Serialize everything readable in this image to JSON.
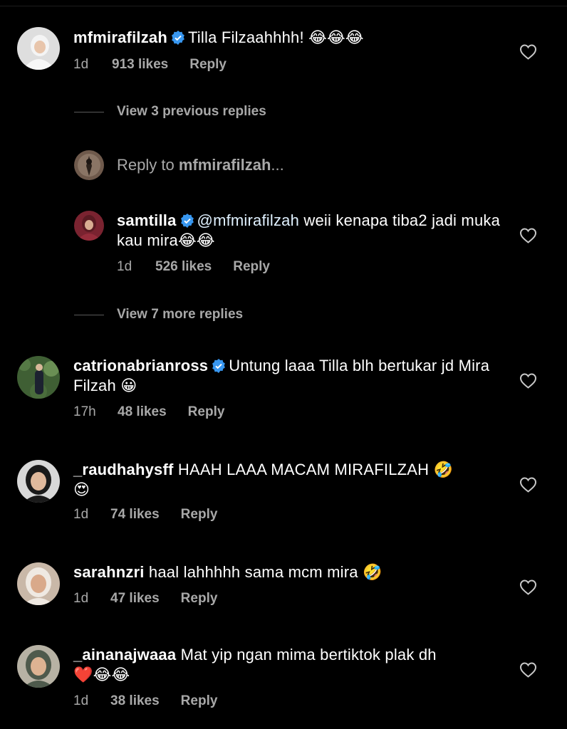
{
  "comments": [
    {
      "username": "mfmirafilzah",
      "verified": true,
      "text": "Tilla Filzaahhhh! ",
      "emoji": [
        "😂",
        "😂",
        "😂"
      ],
      "time": "1d",
      "likes": "913 likes",
      "reply": "Reply"
    },
    {
      "username": "samtilla",
      "verified": true,
      "mention": "@mfmirafilzah",
      "text": " weii kenapa tiba2 jadi muka kau mira",
      "emoji": [
        "😂",
        "😂"
      ],
      "time": "1d",
      "likes": "526 likes",
      "reply": "Reply"
    },
    {
      "username": "catrionabrianross",
      "verified": true,
      "text": "Untung laaa Tilla blh bertukar jd Mira Filzah ",
      "emoji": [
        "😀"
      ],
      "time": "17h",
      "likes": "48 likes",
      "reply": "Reply"
    },
    {
      "username": "_raudhahysff",
      "verified": false,
      "text": " HAAH LAAA MACAM MIRAFILZAH ",
      "emoji": [
        "🤣",
        "😍"
      ],
      "time": "1d",
      "likes": "74 likes",
      "reply": "Reply"
    },
    {
      "username": "sarahnzri",
      "verified": false,
      "text": " haal lahhhhh sama mcm mira ",
      "emoji": [
        "🤣"
      ],
      "time": "1d",
      "likes": "47 likes",
      "reply": "Reply"
    },
    {
      "username": "_ainanajwaaa",
      "verified": false,
      "text": " Mat yip ngan mima bertiktok plak dh",
      "emoji": [
        "❤️",
        "😂",
        "😂"
      ],
      "time": "1d",
      "likes": "38 likes",
      "reply": "Reply"
    }
  ],
  "view_previous": "View 3 previous replies",
  "view_more": "View 7 more replies",
  "reply_to": {
    "prefix": "Reply to ",
    "username": "mfmirafilzah",
    "suffix": "..."
  },
  "colors": {
    "background": "#000000",
    "secondary_text": "#a8a8a8",
    "verified_badge": "#3897f0",
    "mention": "#e0f1ff"
  }
}
